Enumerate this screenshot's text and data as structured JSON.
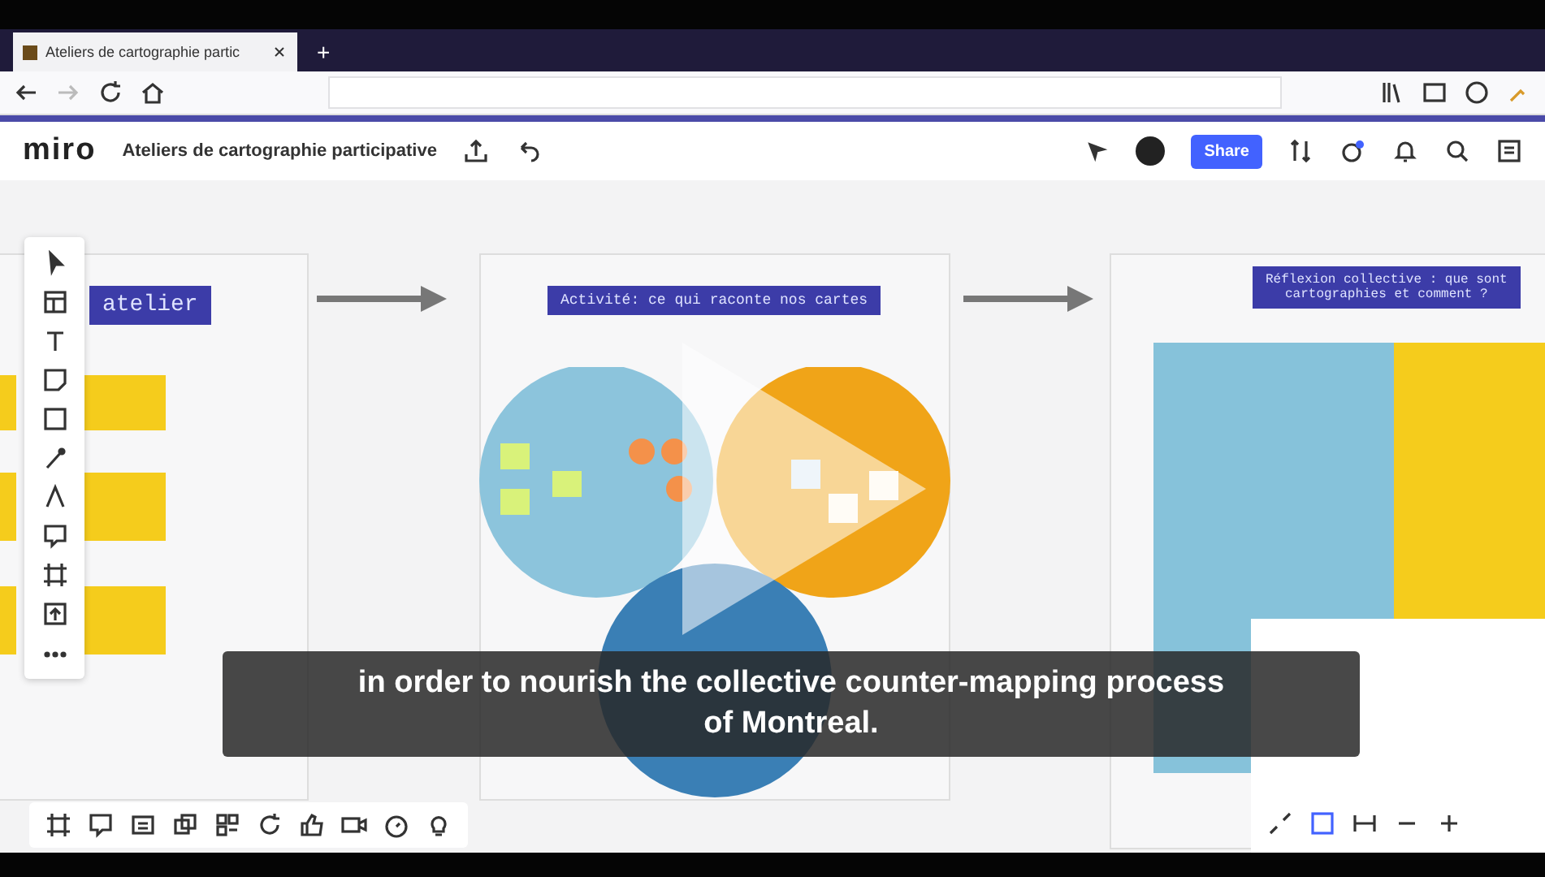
{
  "browser": {
    "tab_title": "Ateliers de cartographie partic",
    "new_tab": "+"
  },
  "app": {
    "logo": "miro",
    "board_title": "Ateliers de cartographie participative",
    "share_label": "Share"
  },
  "frames": [
    {
      "title_lines": [
        "atelier"
      ]
    },
    {
      "title_lines": [
        "Activité: ce qui raconte nos cartes"
      ]
    },
    {
      "title_lines": [
        "Réflexion collective : que sont",
        "cartographies et comment ?"
      ]
    }
  ],
  "subtitle": {
    "lines": [
      "in order to nourish the collective counter-mapping process",
      "of Montreal."
    ]
  }
}
